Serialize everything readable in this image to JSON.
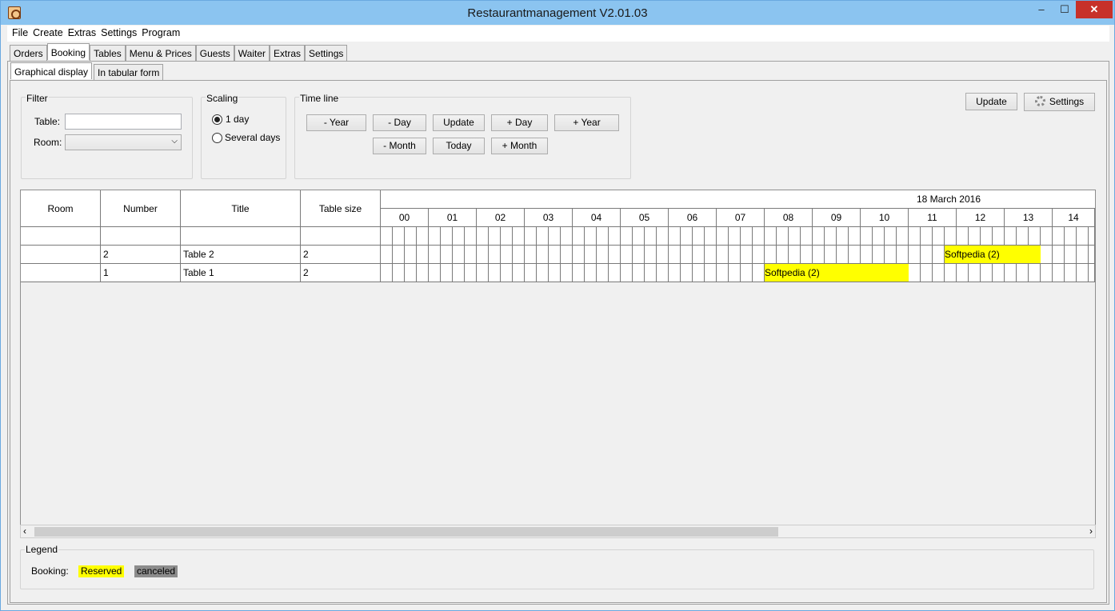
{
  "window": {
    "title": "Restaurantmanagement V2.01.03",
    "min": "–",
    "max": "☐",
    "close": "✕"
  },
  "menu": [
    "File",
    "Create",
    "Extras",
    "Settings",
    "Program"
  ],
  "tabs": [
    "Orders",
    "Booking",
    "Tables",
    "Menu & Prices",
    "Guests",
    "Waiter",
    "Extras",
    "Settings"
  ],
  "subtabs": [
    "Graphical display",
    "In tabular form"
  ],
  "filter": {
    "title": "Filter",
    "table_label": "Table:",
    "table_value": "",
    "room_label": "Room:",
    "room_value": ""
  },
  "scaling": {
    "title": "Scaling",
    "options": [
      "1 day",
      "Several days"
    ],
    "selected": "1 day"
  },
  "timeline": {
    "title": "Time line",
    "minus_year": "- Year",
    "minus_day": "- Day",
    "update": "Update",
    "plus_day": "+ Day",
    "plus_year": "+ Year",
    "minus_month": "- Month",
    "today": "Today",
    "plus_month": "+ Month"
  },
  "actions": {
    "update": "Update",
    "settings": "Settings"
  },
  "grid": {
    "date": "18 March 2016",
    "columns": [
      "Room",
      "Number",
      "Title",
      "Table size"
    ],
    "hours": [
      "00",
      "01",
      "02",
      "03",
      "04",
      "05",
      "06",
      "07",
      "08",
      "09",
      "10",
      "11",
      "12",
      "13",
      "14"
    ],
    "rows": [
      {
        "room": "",
        "number": "",
        "title": "",
        "size": ""
      },
      {
        "room": "",
        "number": "2",
        "title": "Table 2",
        "size": "2"
      },
      {
        "room": "",
        "number": "1",
        "title": "Table 1",
        "size": "2"
      }
    ],
    "bookings": [
      {
        "row": 1,
        "label": "Softpedia (2)",
        "start": 11.75,
        "end": 13.75,
        "status": "Reserved"
      },
      {
        "row": 2,
        "label": "Softpedia (2)",
        "start": 8.0,
        "end": 11.0,
        "status": "Reserved"
      }
    ]
  },
  "legend": {
    "title": "Legend",
    "booking_label": "Booking:",
    "reserved": "Reserved",
    "canceled": "canceled",
    "reserved_color": "#ffff00",
    "canceled_color": "#8c8c8c"
  }
}
